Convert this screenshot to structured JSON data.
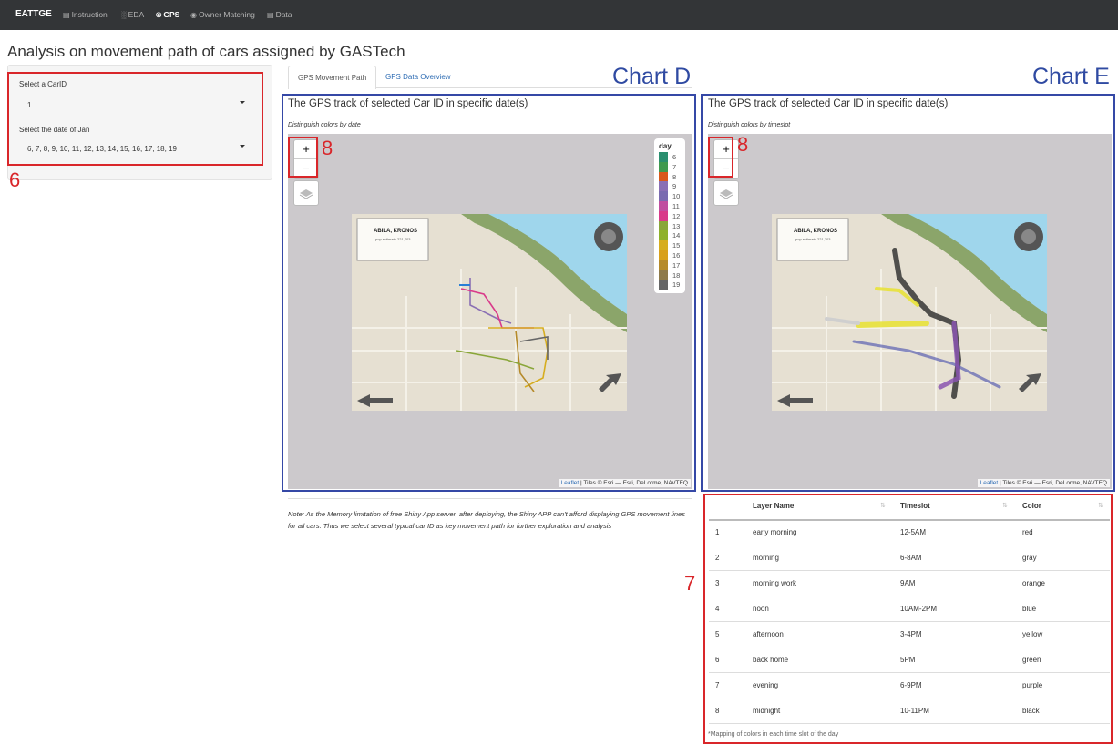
{
  "navbar": {
    "brand": "EATTGE",
    "items": [
      {
        "label": "Instruction",
        "icon": "map-icon"
      },
      {
        "label": "EDA",
        "icon": "bar-chart-icon"
      },
      {
        "label": "GPS",
        "icon": "compass-icon",
        "active": true
      },
      {
        "label": "Owner Matching",
        "icon": "eye-icon"
      },
      {
        "label": "Data",
        "icon": "database-icon"
      }
    ]
  },
  "page_title": "Analysis on movement path of cars assigned by GASTech",
  "sidebar": {
    "car_label": "Select a CarID",
    "car_value": "1",
    "date_label": "Select the date of Jan",
    "date_value": "6, 7, 8, 9, 10, 11, 12, 13, 14, 15, 16, 17, 18, 19"
  },
  "tabs": [
    {
      "label": "GPS Movement Path",
      "active": true
    },
    {
      "label": "GPS Data Overview",
      "active": false
    }
  ],
  "annotations": {
    "chart_d": "Chart D",
    "chart_e": "Chart E",
    "n6": "6",
    "n7": "7",
    "n8a": "8",
    "n8b": "8"
  },
  "map_d": {
    "title": "The GPS track of selected Car ID in specific date(s)",
    "subtitle": "Distinguish colors by date",
    "zoom_in": "+",
    "zoom_out": "−",
    "attribution_link": "Leaflet",
    "attribution": " | Tiles © Esri — Esri, DeLorme, NAVTEQ",
    "map_label": "ABILA, KRONOS",
    "map_sublabel": "pop.estimate 221,703",
    "legend_title": "day",
    "legend": [
      {
        "label": "6",
        "color": "#2a8f6f"
      },
      {
        "label": "7",
        "color": "#3f9a4e"
      },
      {
        "label": "8",
        "color": "#d9591b"
      },
      {
        "label": "9",
        "color": "#8a6fb4"
      },
      {
        "label": "10",
        "color": "#7a6bb0"
      },
      {
        "label": "11",
        "color": "#c04fa0"
      },
      {
        "label": "12",
        "color": "#d93a8a"
      },
      {
        "label": "13",
        "color": "#8aa63a"
      },
      {
        "label": "14",
        "color": "#8fb12a"
      },
      {
        "label": "15",
        "color": "#d6ad1f"
      },
      {
        "label": "16",
        "color": "#d8a01c"
      },
      {
        "label": "17",
        "color": "#b58a2a"
      },
      {
        "label": "18",
        "color": "#8e7a4a"
      },
      {
        "label": "19",
        "color": "#666666"
      }
    ]
  },
  "map_e": {
    "title": "The GPS track of selected Car ID in specific date(s)",
    "subtitle": "Distinguish colors by timeslot",
    "zoom_in": "+",
    "zoom_out": "−",
    "attribution_link": "Leaflet",
    "attribution": " | Tiles © Esri — Esri, DeLorme, NAVTEQ",
    "map_label": "ABILA, KRONOS",
    "map_sublabel": "pop.estimate 221,703"
  },
  "note": "Note: As the Memory limitation of free Shiny App server, after deploying, the Shiny APP can't afford displaying GPS movement lines for all cars. Thus we select several typical car ID as key movement path for further exploration and analysis",
  "table": {
    "headers": [
      "",
      "Layer Name",
      "Timeslot",
      "Color"
    ],
    "rows": [
      [
        "1",
        "early morning",
        "12-5AM",
        "red"
      ],
      [
        "2",
        "morning",
        "6-8AM",
        "gray"
      ],
      [
        "3",
        "morning work",
        "9AM",
        "orange"
      ],
      [
        "4",
        "noon",
        "10AM-2PM",
        "blue"
      ],
      [
        "5",
        "afternoon",
        "3-4PM",
        "yellow"
      ],
      [
        "6",
        "back home",
        "5PM",
        "green"
      ],
      [
        "7",
        "evening",
        "6-9PM",
        "purple"
      ],
      [
        "8",
        "midnight",
        "10-11PM",
        "black"
      ]
    ],
    "caption": "*Mapping of colors in each time slot of the day"
  },
  "colors": {
    "navbar_bg": "#333537",
    "annotation_red": "#d9262a",
    "annotation_blue": "#2f4aa2"
  }
}
